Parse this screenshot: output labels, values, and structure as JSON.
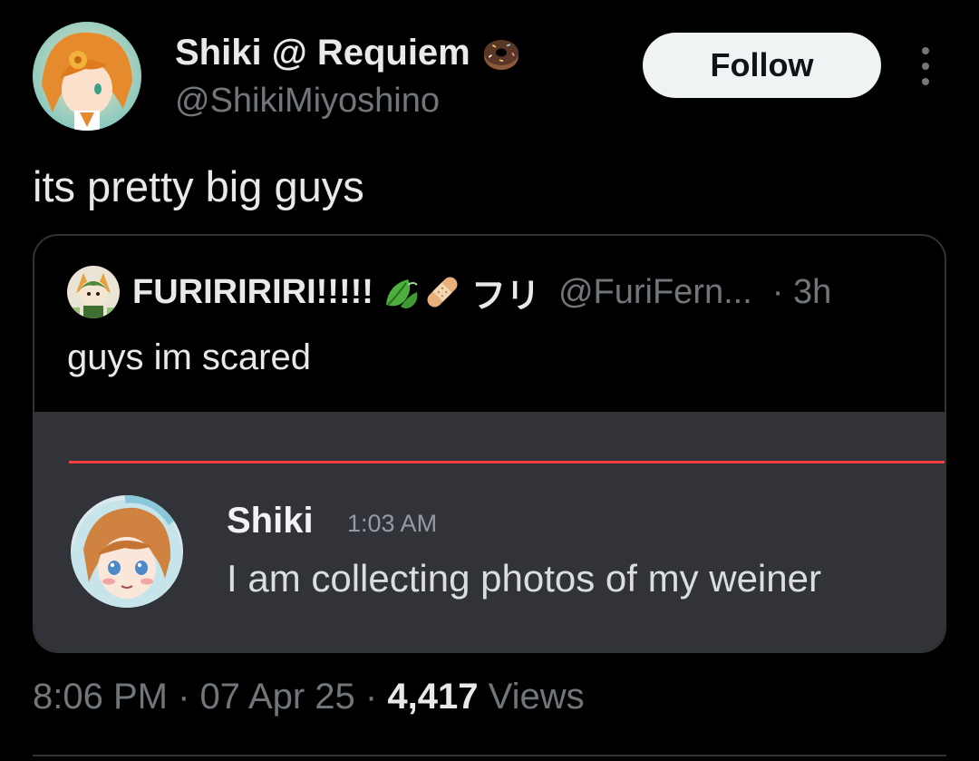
{
  "tweet": {
    "author": {
      "display_name": "Shiki @ Requiem",
      "handle": "@ShikiMiyoshino",
      "badge_icon": "donut-icon"
    },
    "follow_label": "Follow",
    "text": "its pretty big guys",
    "timestamp": "8:06 PM",
    "date": "07 Apr 25",
    "separator": "·",
    "views_count": "4,417",
    "views_label": "Views"
  },
  "quote": {
    "display_name": "FURIRIRIRI!!!!!",
    "emoji_icons": [
      "leaf-icon",
      "bandage-icon"
    ],
    "name_suffix": "フリ",
    "handle": "@FuriFern...",
    "time": "· 3h",
    "text": "guys im scared",
    "media": {
      "username": "Shiki",
      "time": "1:03 AM",
      "message": "I am collecting photos of my weiner",
      "divider_color": "#f23f43",
      "background_color": "#313338"
    }
  },
  "colors": {
    "background": "#000000",
    "primary_text": "#e7e9ea",
    "secondary_text": "#71767b",
    "border": "#2f3336",
    "follow_button_bg": "#eff3f4"
  }
}
